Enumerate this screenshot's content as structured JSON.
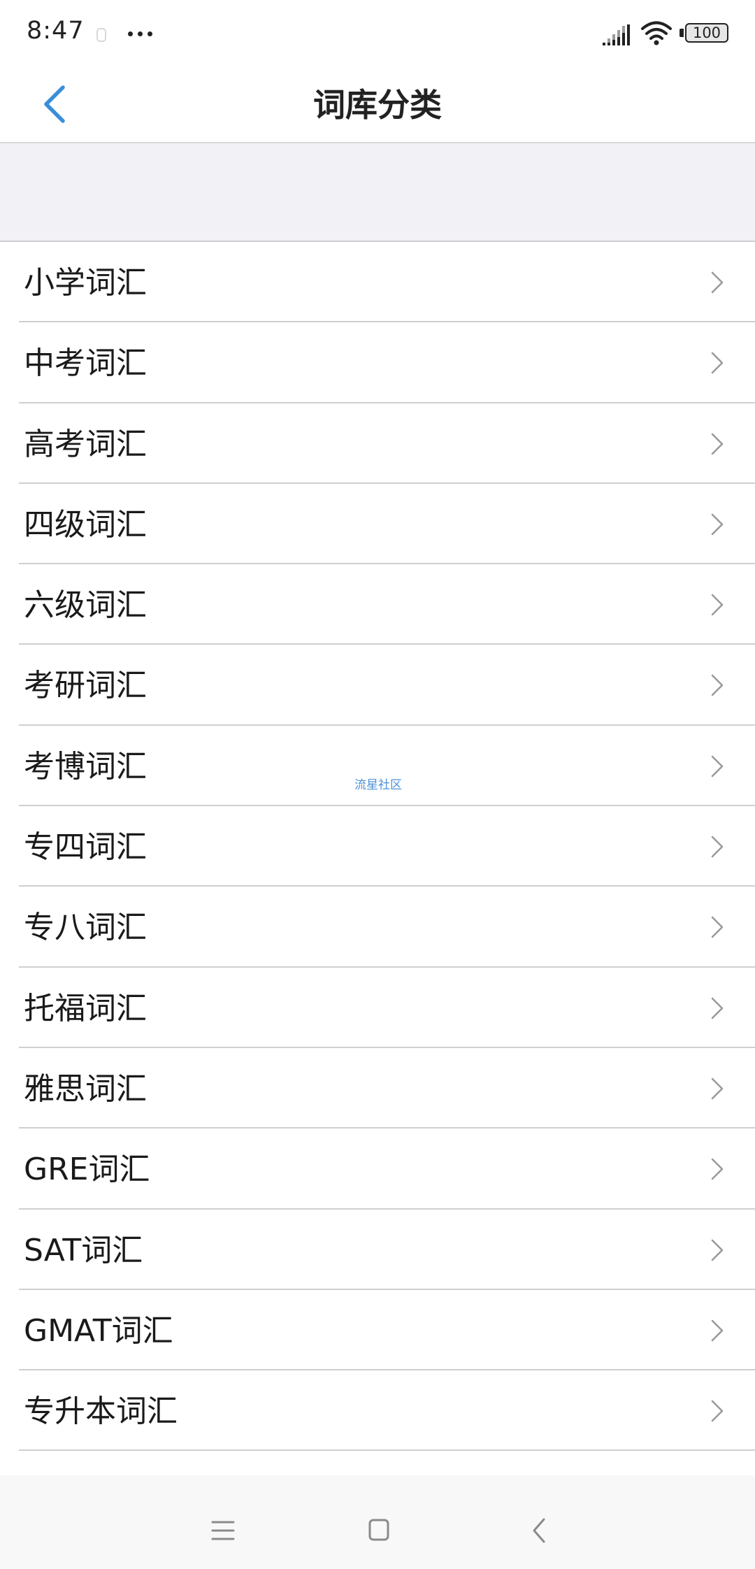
{
  "status_bar": {
    "time": "8:47",
    "battery": "100",
    "icons": [
      "alarm-icon",
      "more-dots-icon",
      "signal-icon",
      "wifi-icon",
      "battery-icon"
    ]
  },
  "header": {
    "title": "词库分类",
    "back_icon": "chevron-left-icon"
  },
  "categories": [
    {
      "label": "小学词汇"
    },
    {
      "label": "中考词汇"
    },
    {
      "label": "高考词汇"
    },
    {
      "label": "四级词汇"
    },
    {
      "label": "六级词汇"
    },
    {
      "label": "考研词汇"
    },
    {
      "label": "考博词汇"
    },
    {
      "label": "专四词汇"
    },
    {
      "label": "专八词汇"
    },
    {
      "label": "托福词汇"
    },
    {
      "label": "雅思词汇"
    },
    {
      "label": "GRE词汇"
    },
    {
      "label": "SAT词汇"
    },
    {
      "label": "GMAT词汇"
    },
    {
      "label": "专升本词汇"
    }
  ],
  "watermark": "流星社区",
  "bottom_nav": {
    "icons": [
      "menu-icon",
      "home-icon",
      "back-icon"
    ]
  },
  "colors": {
    "accent": "#3a8fd9",
    "divider": "#cfcfcf",
    "spacer_bg": "#f1f1f6",
    "bottom_nav_bg": "#f8f8f8"
  }
}
